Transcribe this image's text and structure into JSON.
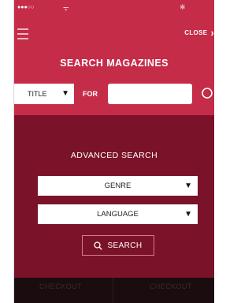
{
  "status_bar": {
    "signal_dots": "●●●○○",
    "wifi_glyph": "ᯤ",
    "bluetooth_glyph": "✱"
  },
  "header": {
    "menu_icon": "hamburger-icon",
    "close_label": "CLOSE",
    "close_icon": "chevron-right-icon"
  },
  "search": {
    "title": "SEARCH MAGAZINES",
    "field_select_value": "TITLE",
    "for_label": "FOR",
    "query_value": "",
    "search_icon": "search-icon"
  },
  "advanced": {
    "title": "ADVANCED SEARCH",
    "genre_label": "GENRE",
    "language_label": "LANGUAGE",
    "search_button_label": "SEARCH"
  },
  "bottom_bar": {
    "left_label": "CHECKOUT",
    "right_label": "CHECKOUT"
  },
  "colors": {
    "header_red": "#c52c48",
    "body_maroon": "#7a1229",
    "bottom_dark": "#1b0c0f"
  }
}
